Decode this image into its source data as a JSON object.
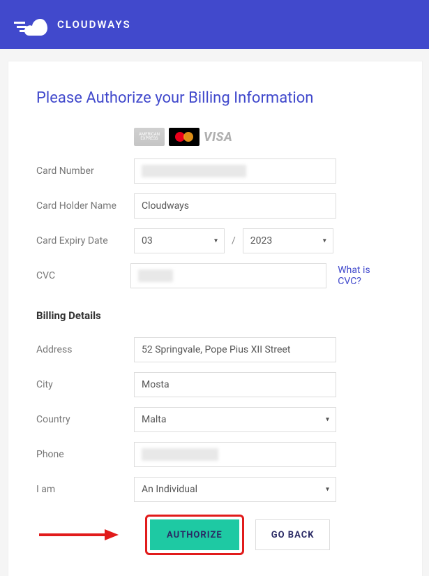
{
  "header": {
    "brand": "CLOUDWAYS"
  },
  "page": {
    "title": "Please Authorize your Billing Information",
    "card_icons": [
      "amex",
      "mastercard",
      "visa"
    ],
    "visa_label": "VISA"
  },
  "card_form": {
    "card_number_label": "Card Number",
    "card_number_value": "",
    "holder_label": "Card Holder Name",
    "holder_value": "Cloudways",
    "expiry_label": "Card Expiry Date",
    "expiry_month": "03",
    "expiry_year": "2023",
    "expiry_sep": "/",
    "cvc_label": "CVC",
    "cvc_value": "",
    "cvc_help": "What is CVC?"
  },
  "billing": {
    "section_title": "Billing Details",
    "address_label": "Address",
    "address_value": "52 Springvale, Pope Pius XII Street",
    "city_label": "City",
    "city_value": "Mosta",
    "country_label": "Country",
    "country_value": "Malta",
    "phone_label": "Phone",
    "phone_value": "",
    "iam_label": "I am",
    "iam_value": "An Individual"
  },
  "buttons": {
    "authorize": "AUTHORIZE",
    "go_back": "GO BACK"
  }
}
